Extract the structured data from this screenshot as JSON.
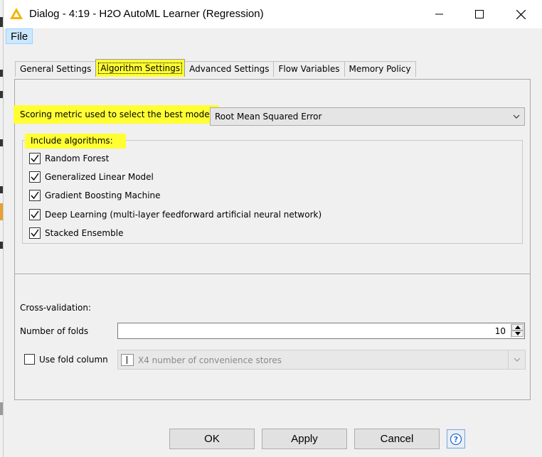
{
  "window": {
    "title": "Dialog - 4:19 - H2O AutoML Learner (Regression)"
  },
  "menu": {
    "file": "File"
  },
  "tabs": [
    {
      "label": "General Settings"
    },
    {
      "label": "Algorithm Settings"
    },
    {
      "label": "Advanced Settings"
    },
    {
      "label": "Flow Variables"
    },
    {
      "label": "Memory Policy"
    }
  ],
  "scoring": {
    "label": "Scoring metric used to select the best model",
    "value": "Root Mean Squared Error"
  },
  "algorithms": {
    "title": "Include algorithms:",
    "items": [
      {
        "label": "Random Forest",
        "checked": true
      },
      {
        "label": "Generalized Linear Model",
        "checked": true
      },
      {
        "label": "Gradient Boosting Machine",
        "checked": true
      },
      {
        "label": "Deep Learning (multi-layer feedforward artificial neural network)",
        "checked": true
      },
      {
        "label": "Stacked Ensemble",
        "checked": true
      }
    ]
  },
  "cross_validation": {
    "title": "Cross-validation:",
    "folds_label": "Number of folds",
    "folds_value": "10",
    "fold_column_label": "Use fold column",
    "fold_column_checked": false,
    "fold_column_value": "X4 number of convenience stores"
  },
  "buttons": {
    "ok": "OK",
    "apply": "Apply",
    "cancel": "Cancel"
  },
  "colors": {
    "highlight": "#ffff33",
    "dialog_bg": "#f0f0f0",
    "help_blue": "#2a6fd1"
  }
}
